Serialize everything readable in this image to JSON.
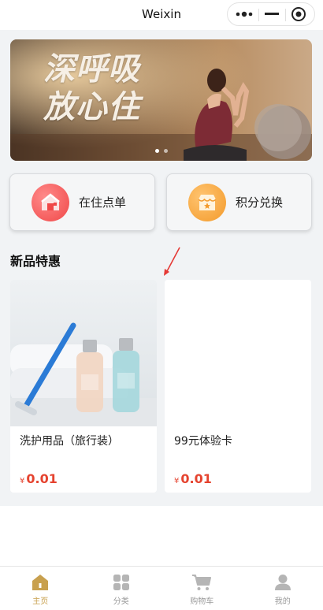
{
  "window": {
    "title": "Weixin"
  },
  "capsule": {
    "more_icon": "more-dots-icon",
    "minimize_icon": "minimize-icon",
    "close_icon": "close-target-icon"
  },
  "banner": {
    "line1": "深呼吸",
    "line2": "放心住",
    "slide_count": 2,
    "active_slide": 1
  },
  "actions": [
    {
      "label": "在住点单",
      "icon": "house-icon",
      "color": "#f05a5a"
    },
    {
      "label": "积分兑换",
      "icon": "shop-icon",
      "color": "#f4a73a"
    }
  ],
  "section": {
    "title": "新品特惠"
  },
  "products": [
    {
      "name": "洗护用品（旅行装）",
      "currency": "¥",
      "price": "0.01",
      "has_image": true
    },
    {
      "name": "99元体验卡",
      "currency": "¥",
      "price": "0.01",
      "has_image": false
    }
  ],
  "tabbar": {
    "items": [
      {
        "label": "主页",
        "icon": "home-icon",
        "active": true
      },
      {
        "label": "分类",
        "icon": "category-grid-icon",
        "active": false
      },
      {
        "label": "购物车",
        "icon": "cart-icon",
        "active": false
      },
      {
        "label": "我的",
        "icon": "user-icon",
        "active": false
      }
    ]
  },
  "colors": {
    "accent_gold": "#c8a04e",
    "price_red": "#e5432f",
    "annotation_red": "#e53935"
  }
}
